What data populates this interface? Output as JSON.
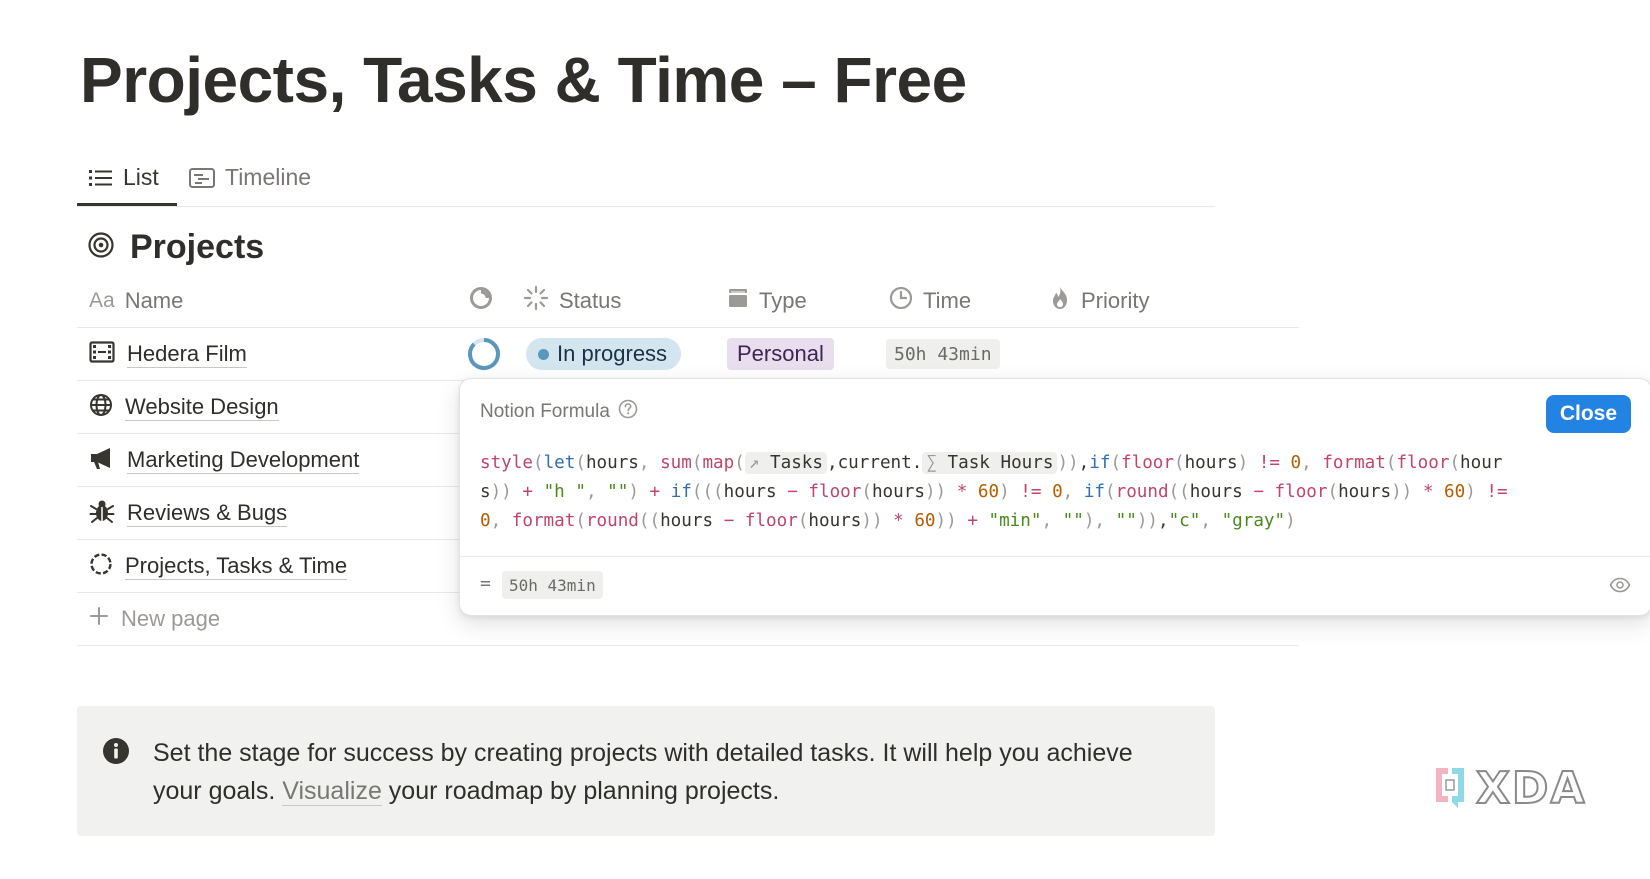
{
  "page": {
    "title": "Projects, Tasks & Time – Free"
  },
  "tabs": [
    {
      "label": "List",
      "icon": "list-icon",
      "active": true
    },
    {
      "label": "Timeline",
      "icon": "timeline-icon",
      "active": false
    }
  ],
  "section": {
    "title": "Projects",
    "icon": "target-icon"
  },
  "columns": [
    {
      "label": "Name",
      "prefix": "Aa",
      "icon": "text-property-icon"
    },
    {
      "label": "",
      "icon": "rollup-progress-icon"
    },
    {
      "label": "Status",
      "icon": "status-icon"
    },
    {
      "label": "Type",
      "icon": "select-icon"
    },
    {
      "label": "Time",
      "icon": "clock-icon"
    },
    {
      "label": "Priority",
      "icon": "fire-icon"
    }
  ],
  "rows": [
    {
      "name": "Hedera Film",
      "icon": "film-icon",
      "status": "In progress",
      "type": "Personal",
      "time": "50h 43min"
    },
    {
      "name": "Website Design",
      "icon": "globe-icon"
    },
    {
      "name": "Marketing Development",
      "icon": "megaphone-icon"
    },
    {
      "name": "Reviews & Bugs",
      "icon": "bug-icon"
    },
    {
      "name": "Projects, Tasks & Time",
      "icon": "dashed-circle-icon"
    }
  ],
  "new_page": {
    "label": "New page",
    "icon": "plus-icon"
  },
  "formula_popup": {
    "title": "Notion Formula",
    "help_icon": "question-icon",
    "close_label": "Close",
    "close_color": "#2383e2",
    "mention_arrow": "↗",
    "mention_sigma": "∑",
    "tokens": {
      "style": "style",
      "let": "let",
      "hours": "hours",
      "sum": "sum",
      "map": "map",
      "tasks": "Tasks",
      "current": "current.",
      "task_hours": "Task Hours",
      "if": "if",
      "floor": "floor",
      "format": "format",
      "round": "round",
      "zero": "0",
      "sixty": "60",
      "h_str": "\"h \"",
      "empty_str": "\"\"",
      "min_str": "\"min\"",
      "c_str": "\"c\"",
      "gray_str": "\"gray\""
    },
    "result_eq": "=",
    "result": "50h 43min",
    "eye_icon": "eye-icon"
  },
  "callout": {
    "icon": "info-icon",
    "text_before": "Set the stage for success by creating projects with detailed tasks. It will help you achieve your goals. ",
    "link_text": "Visualize",
    "text_after": " your roadmap by planning projects."
  },
  "watermark": {
    "text": "XDA"
  },
  "colors": {
    "status_bg": "#d3e5ef",
    "status_dot": "#5b97bd",
    "type_bg": "#e8deee",
    "callout_bg": "#f1f1ef"
  }
}
